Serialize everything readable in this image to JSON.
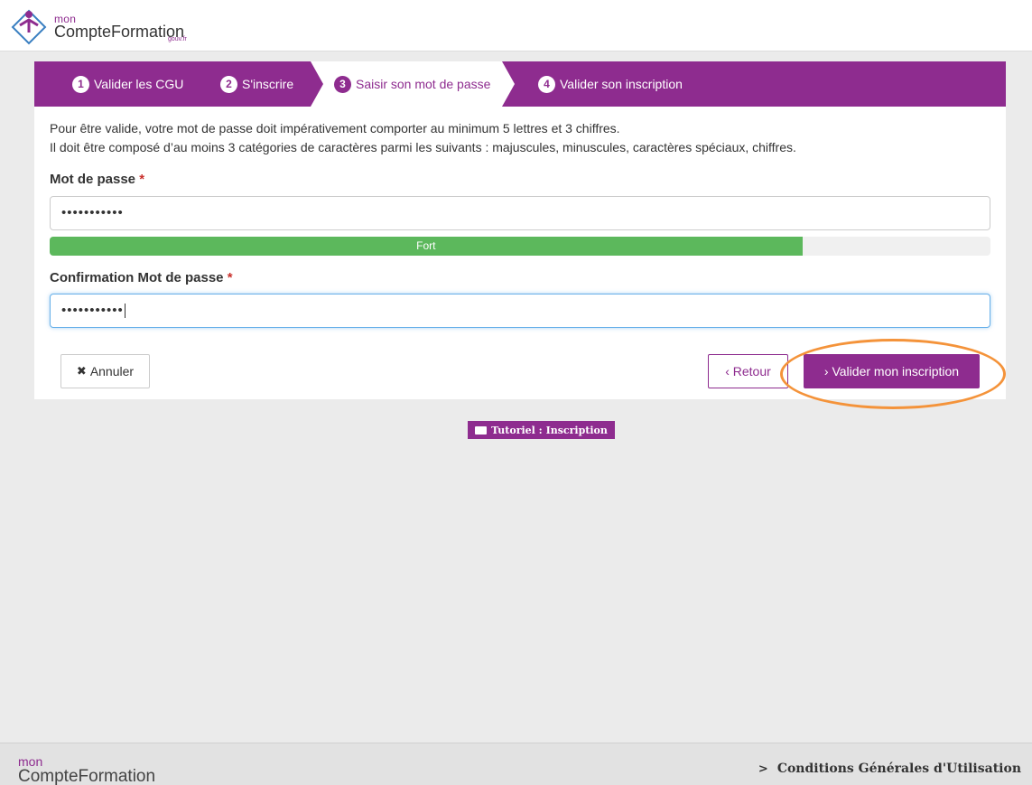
{
  "header": {
    "logo_small": "mon",
    "logo_big": "CompteFormation",
    "logo_gouv": "gouv.fr"
  },
  "steps": [
    {
      "num": "1",
      "label": "Valider les CGU",
      "active": false
    },
    {
      "num": "2",
      "label": "S'inscrire",
      "active": false
    },
    {
      "num": "3",
      "label": "Saisir son mot de passe",
      "active": true
    },
    {
      "num": "4",
      "label": "Valider son inscription",
      "active": false
    }
  ],
  "description": {
    "line1": "Pour être valide, votre mot de passe doit impérativement comporter au minimum 5 lettres et 3 chiffres.",
    "line2": "Il doit être composé d’au moins 3 catégories de caractères parmi les suivants : majuscules, minuscules, caractères spéciaux, chiffres."
  },
  "password": {
    "label": "Mot de passe",
    "required_mark": "*",
    "value": "•••••••••••"
  },
  "strength": {
    "label": "Fort",
    "percent": 80,
    "color": "#5cb85c"
  },
  "confirm": {
    "label": "Confirmation Mot de passe",
    "required_mark": "*",
    "value": "•••••••••••"
  },
  "buttons": {
    "cancel_icon": "close-icon",
    "cancel": "Annuler",
    "back": "‹ Retour",
    "validate": "› Valider mon inscription"
  },
  "tutorial": {
    "icon": "video-icon",
    "label": "Tutoriel : Inscription"
  },
  "footer": {
    "logo_small": "mon",
    "logo_big": "CompteFormation",
    "link": "Conditions Générales d'Utilisation"
  },
  "colors": {
    "brand": "#8e2c8f",
    "highlight": "#f4933a",
    "strength": "#5cb85c"
  }
}
